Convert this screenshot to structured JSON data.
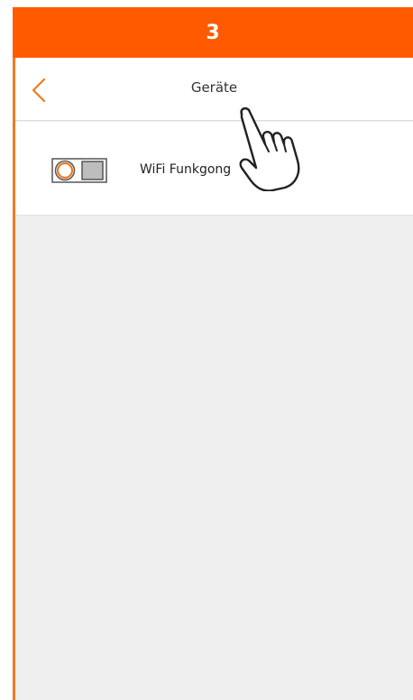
{
  "step": {
    "number": "3"
  },
  "nav": {
    "title": "Geräte",
    "back_icon": "chevron-left-icon"
  },
  "devices": [
    {
      "label": "WiFi Funkgong",
      "icon": "doorbell-chime-icon"
    }
  ],
  "pointer": {
    "icon": "hand-pointer-icon"
  },
  "colors": {
    "accent": "#ff5a00",
    "border_accent": "#f07a22",
    "background": "#efefef",
    "surface": "#ffffff"
  }
}
